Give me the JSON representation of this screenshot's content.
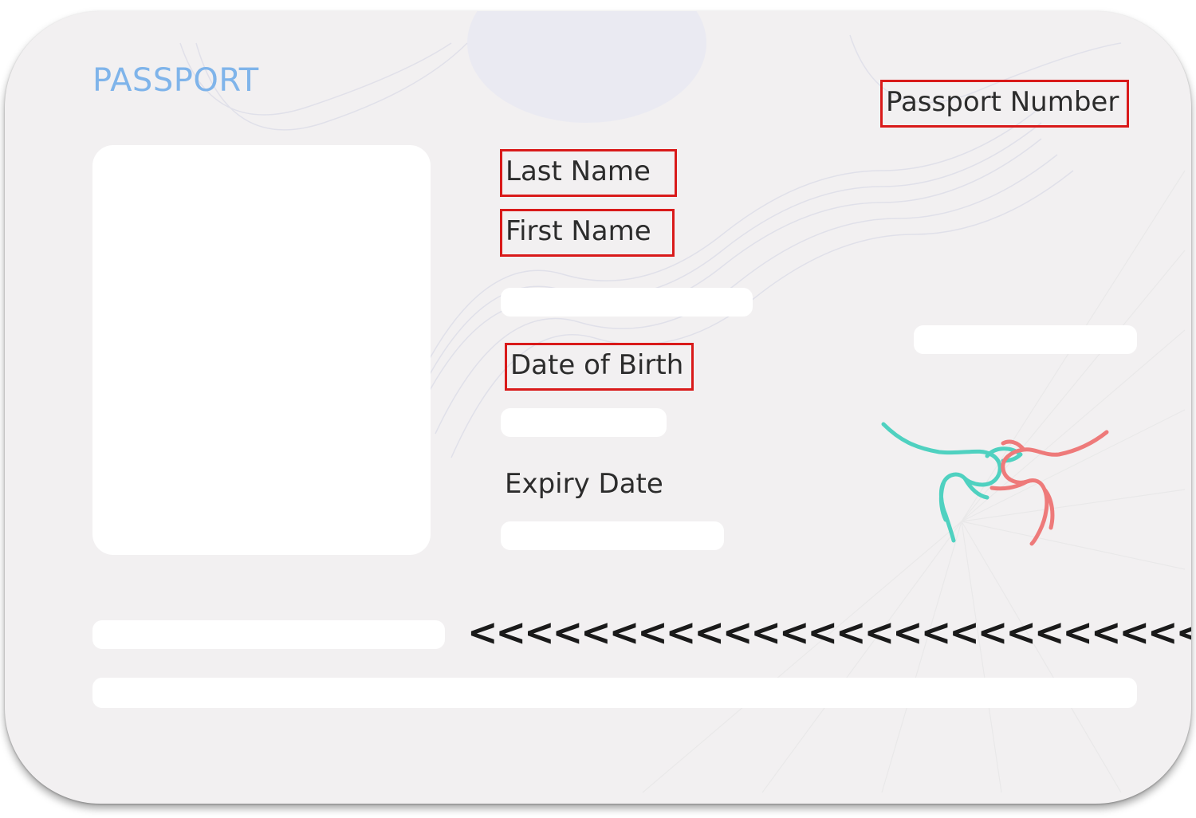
{
  "card": {
    "title": "PASSPORT",
    "labels": {
      "passport_number": "Passport Number",
      "last_name": "Last Name",
      "first_name": "First Name",
      "date_of_birth": "Date of Birth",
      "expiry_date": "Expiry Date"
    },
    "mrz_line": "<<<<<<<<<<<<<<<<<<<<<<<<<<<<<<<",
    "emblem_icon": "kangaroo-pair-icon",
    "colors": {
      "title": "#7fb4ea",
      "highlight_box": "#d91a1a",
      "kangaroo_teal": "#4fd1c0",
      "kangaroo_red": "#ee7a7a"
    }
  }
}
